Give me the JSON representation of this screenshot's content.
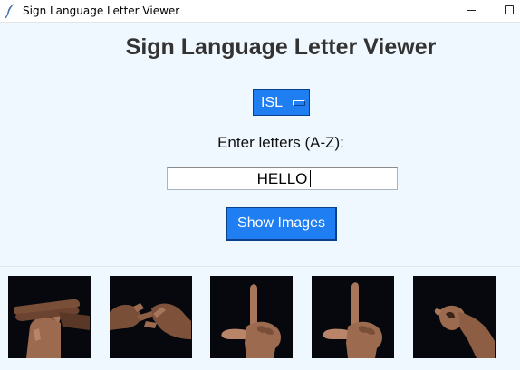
{
  "window": {
    "title": "Sign Language Letter Viewer",
    "icon": "feather-icon"
  },
  "app": {
    "title": "Sign Language Letter Viewer",
    "language_menu": {
      "selected": "ISL",
      "options_visible": [
        "ISL"
      ]
    },
    "prompt_label": "Enter letters (A-Z):",
    "input_value": "HELLO",
    "show_button_label": "Show Images"
  },
  "colors": {
    "background": "#f0f8ff",
    "button": "#1e7ef2",
    "title_text": "#333333",
    "image_bg": "#06080d"
  },
  "images": [
    {
      "letter": "H",
      "alt": "ISL sign for H"
    },
    {
      "letter": "E",
      "alt": "ISL sign for E"
    },
    {
      "letter": "L",
      "alt": "ISL sign for L"
    },
    {
      "letter": "L",
      "alt": "ISL sign for L"
    },
    {
      "letter": "O",
      "alt": "ISL sign for O"
    }
  ]
}
